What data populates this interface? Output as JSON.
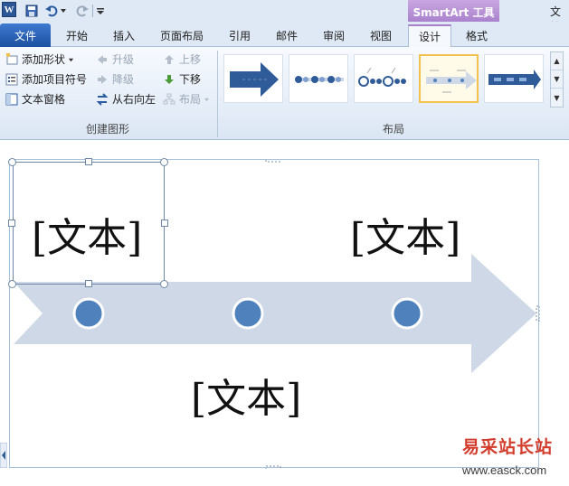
{
  "app": {
    "logo_letter": "W",
    "title_fragment": "文档",
    "context_tab_group": "SmartArt 工具"
  },
  "tabs": [
    {
      "label": "文件"
    },
    {
      "label": "开始"
    },
    {
      "label": "插入"
    },
    {
      "label": "页面布局"
    },
    {
      "label": "引用"
    },
    {
      "label": "邮件"
    },
    {
      "label": "审阅"
    },
    {
      "label": "视图"
    },
    {
      "label": "设计"
    },
    {
      "label": "格式"
    }
  ],
  "ribbon": {
    "create_graphic": {
      "label": "创建图形",
      "add_shape": "添加形状",
      "add_bullet": "添加项目符号",
      "text_pane": "文本窗格",
      "promote": "升级",
      "demote": "降级",
      "right_to_left": "从右向左",
      "move_up": "上移",
      "move_down": "下移",
      "layout": "布局"
    },
    "layouts": {
      "label": "布局",
      "items": [
        "block-arrow",
        "dots-arrow-process",
        "circle-chain",
        "timeline-arrow",
        "chevron-arrow"
      ],
      "selected_index": 3
    }
  },
  "smartart": {
    "placeholder_1": "[文本]",
    "placeholder_2": "[文本]",
    "placeholder_3": "[文本]",
    "arrow_color": "#cfd8e6",
    "dot_color": "#4f81bd"
  },
  "watermark": {
    "line1": "易采站长站",
    "line2": "www.easck.com"
  },
  "colors": {
    "file_tab": "#2b62b8",
    "context_accent": "#a77fcc",
    "selected_layout_border": "#f2c14e"
  }
}
